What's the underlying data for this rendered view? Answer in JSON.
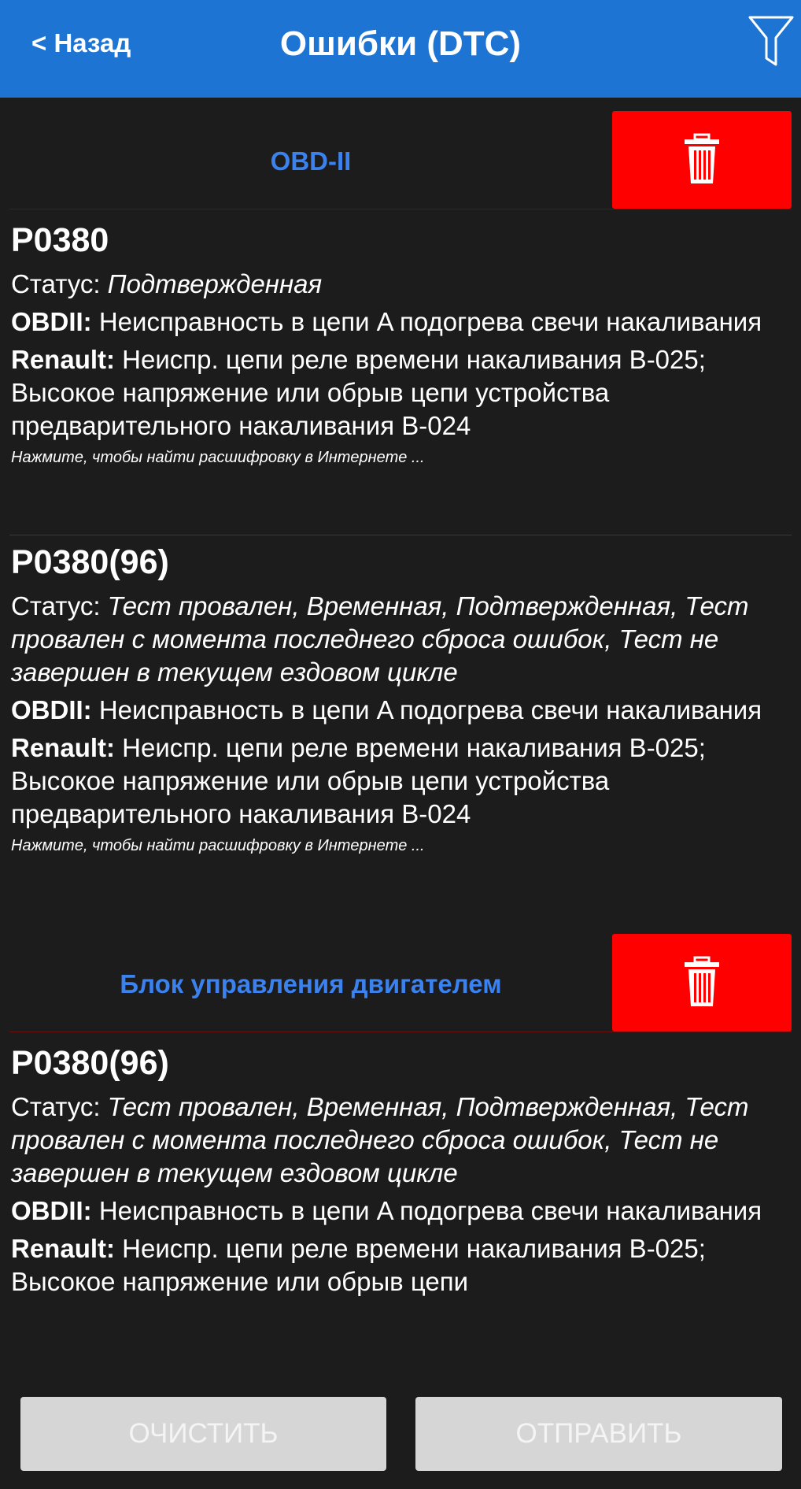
{
  "header": {
    "back_label": "< Назад",
    "title": "Ошибки (DTC)"
  },
  "groups": [
    {
      "title": "OBD-II",
      "entries": [
        {
          "code": "P0380",
          "status_label": "Статус:",
          "status_value": "Подтвержденная",
          "obd_label": "OBDII:",
          "obd_text": "Неисправность в цепи A подогрева свечи накаливания",
          "maker_label": "Renault:",
          "maker_text": "Неиспр. цепи реле времени накаливания B-025; Высокое напряжение или обрыв цепи устройства предварительного накаливания B-024",
          "hint": "Нажмите, чтобы найти расшифровку в Интернете ..."
        },
        {
          "code": "P0380(96)",
          "status_label": "Статус:",
          "status_value": "Тест провален, Временная, Подтвержденная, Тест провален с момента последнего сброса ошибок, Тест не завершен в текущем ездовом цикле",
          "obd_label": "OBDII:",
          "obd_text": "Неисправность в цепи A подогрева свечи накаливания",
          "maker_label": "Renault:",
          "maker_text": "Неиспр. цепи реле времени накаливания B-025; Высокое напряжение или обрыв цепи устройства предварительного накаливания B-024",
          "hint": "Нажмите, чтобы найти расшифровку в Интернете ..."
        }
      ]
    },
    {
      "title": "Блок управления двигателем",
      "entries": [
        {
          "code": "P0380(96)",
          "status_label": "Статус:",
          "status_value": "Тест провален, Временная, Подтвержденная, Тест провален с момента последнего сброса ошибок, Тест не завершен в текущем ездовом цикле",
          "obd_label": "OBDII:",
          "obd_text": "Неисправность в цепи A подогрева свечи накаливания",
          "maker_label": "Renault:",
          "maker_text": "Неиспр. цепи реле времени накаливания B-025; Высокое напряжение или обрыв цепи"
        }
      ]
    }
  ],
  "buttons": {
    "clear": "ОЧИСТИТЬ",
    "send": "ОТПРАВИТЬ"
  },
  "colors": {
    "header_bg": "#1e74d2",
    "group_title": "#3b82ee",
    "delete_bg": "#ff0000",
    "background": "#1c1c1c"
  },
  "icons": {
    "filter": "filter-icon",
    "delete": "trash-icon"
  }
}
